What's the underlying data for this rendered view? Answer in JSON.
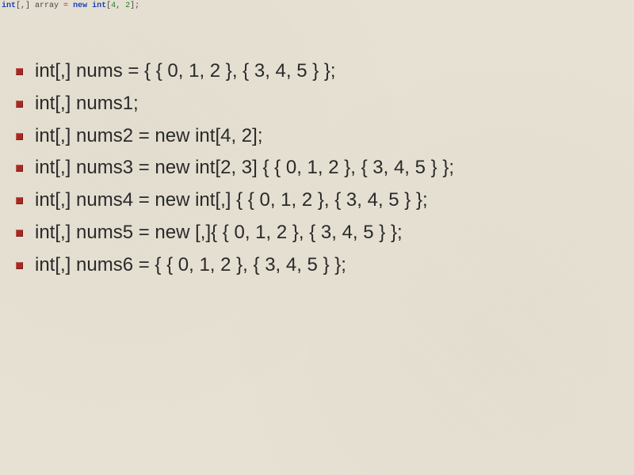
{
  "header": {
    "type_tok": "int",
    "bracket_tok": "[,] ",
    "var_tok": "array ",
    "eq_tok": "= ",
    "new_tok": "new ",
    "type2_tok": "int",
    "dims_open": "[",
    "dim1": "4",
    "comma": ", ",
    "dim2": "2",
    "dims_close": "];"
  },
  "lines": [
    "int[,] nums = { { 0, 1, 2 }, { 3, 4, 5 } };",
    "int[,] nums1;",
    "int[,] nums2 = new int[4, 2];",
    "int[,] nums3 = new int[2, 3] { { 0, 1, 2 }, { 3, 4, 5 } };",
    "int[,] nums4 = new int[,] { { 0, 1, 2 }, { 3, 4, 5 } };",
    "int[,] nums5 = new [,]{ { 0, 1, 2 }, { 3, 4, 5 } };",
    "int[,] nums6 = { { 0, 1, 2 }, { 3, 4, 5 } };"
  ]
}
